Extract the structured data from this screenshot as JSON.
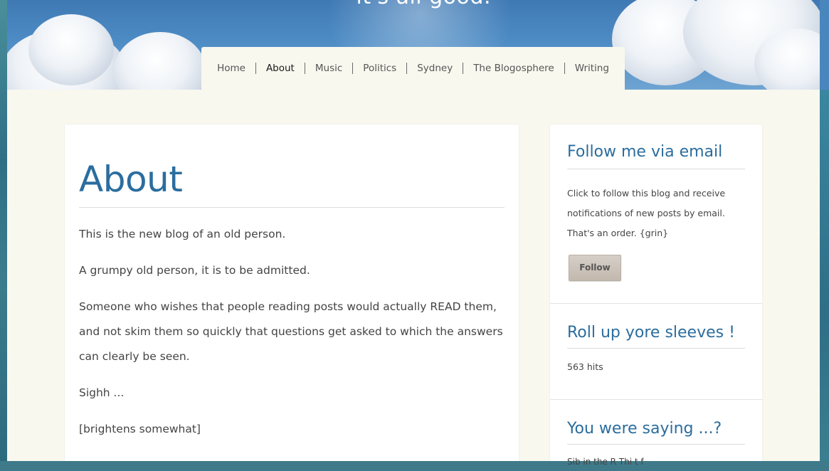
{
  "header": {
    "tagline": "– it's all good."
  },
  "nav": {
    "items": [
      {
        "label": "Home",
        "active": false
      },
      {
        "label": "About",
        "active": true
      },
      {
        "label": "Music",
        "active": false
      },
      {
        "label": "Politics",
        "active": false
      },
      {
        "label": "Sydney",
        "active": false
      },
      {
        "label": "The Blogosphere",
        "active": false
      },
      {
        "label": "Writing",
        "active": false
      }
    ]
  },
  "main": {
    "title": "About",
    "paragraphs": [
      "This is the new blog of an old person.",
      "A grumpy old person, it is to be admitted.",
      "Someone who wishes that people reading posts would actually READ them, and not skim them so quickly that questions get asked to which the answers can clearly be seen.",
      "Sighh ...",
      "[brightens somewhat]"
    ]
  },
  "sidebar": {
    "follow_widget": {
      "title": "Follow me via email",
      "text": "Click to follow this blog and receive notifications of new posts by email. That's an order. {grin}",
      "button_label": "Follow"
    },
    "stats_widget": {
      "title": "Roll up yore sleeves !",
      "hits": "563 hits"
    },
    "comments_widget": {
      "title": "You were saying ...?",
      "partial_text": "Sib   in the R      Thi  t f"
    }
  },
  "colors": {
    "accent": "#2b6d9e",
    "page_background": "#f8f8ef",
    "sky": "#4d8bc4"
  }
}
